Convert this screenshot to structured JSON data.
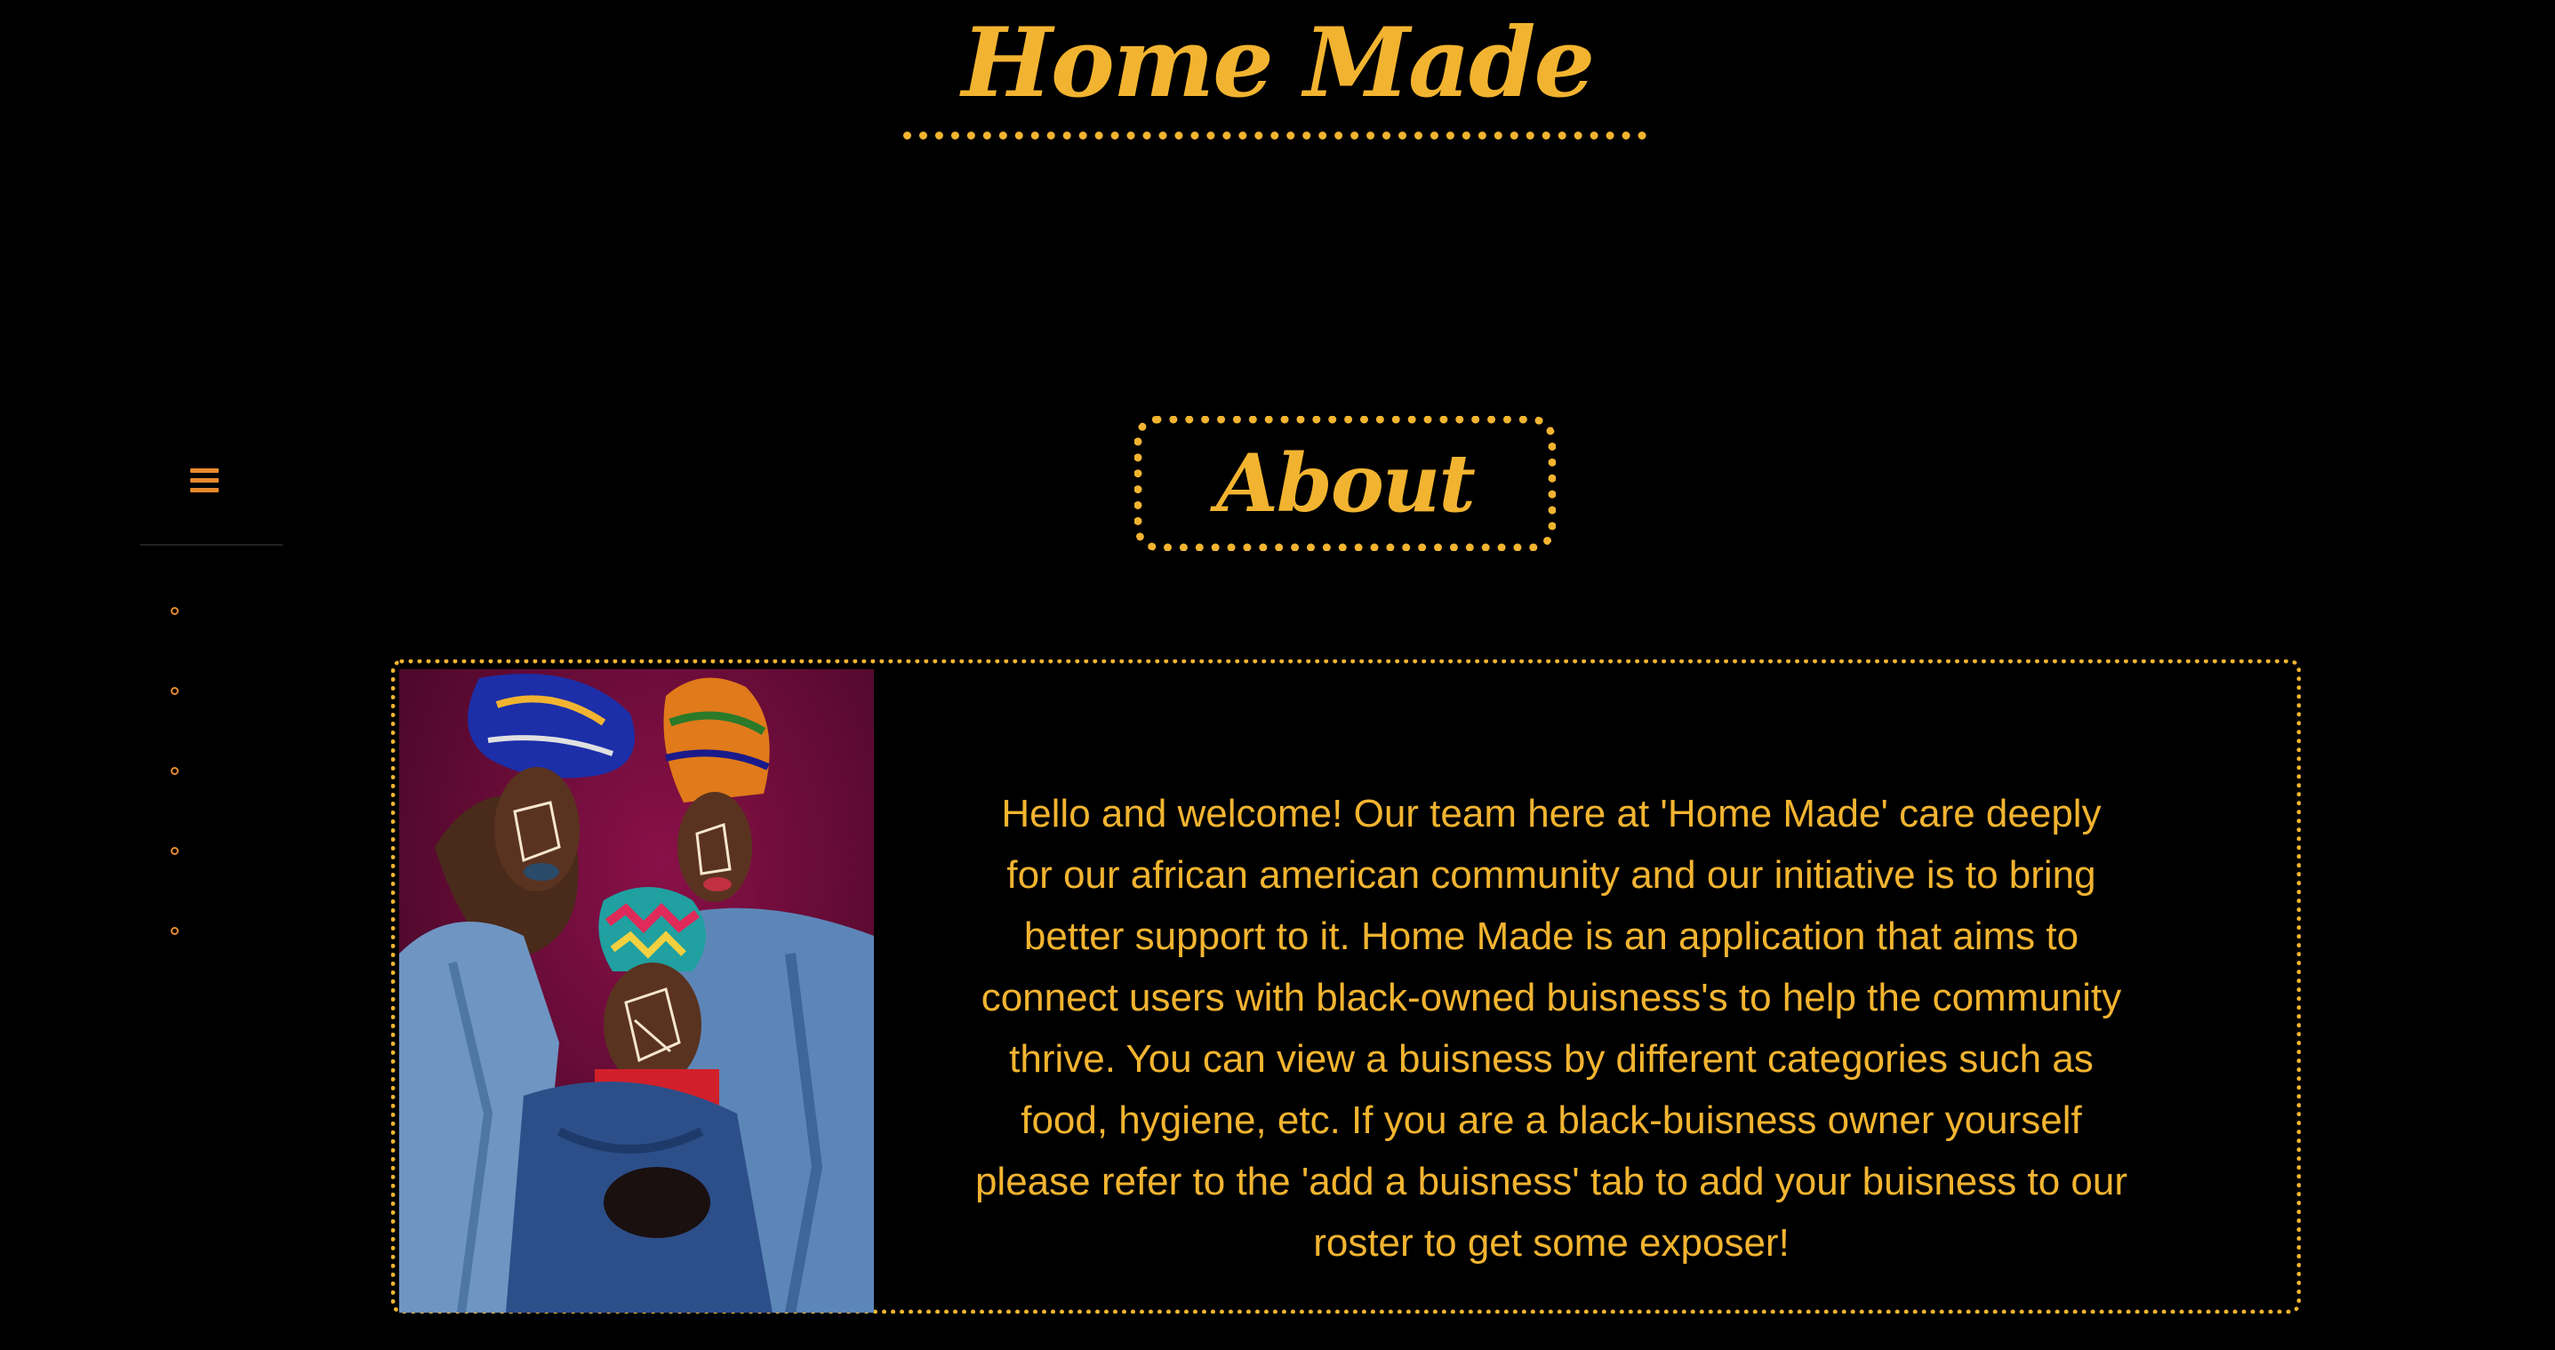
{
  "header": {
    "title": "Home Made"
  },
  "sidebar": {
    "menu_icon": "hamburger-menu-icon",
    "items_count_visible": 5
  },
  "about": {
    "heading": "About",
    "body": "Hello and welcome! Our team here at 'Home Made' care deeply for our african american community and our initiative is to bring better support to it. Home Made is an application that aims to connect users with black-owned buisness's to help the community thrive. You can view a buisness by different categories such as food, hygiene, etc. If you are a black-buisness owner yourself please refer to the 'add a buisness' tab to add your buisness to our roster to get some exposer!",
    "image_alt": "photo-three-women-headwraps"
  },
  "colors": {
    "background": "#000000",
    "accent": "#f2b430",
    "menu_accent": "#e78a2d",
    "image_backdrop": "#6a0a3a"
  }
}
